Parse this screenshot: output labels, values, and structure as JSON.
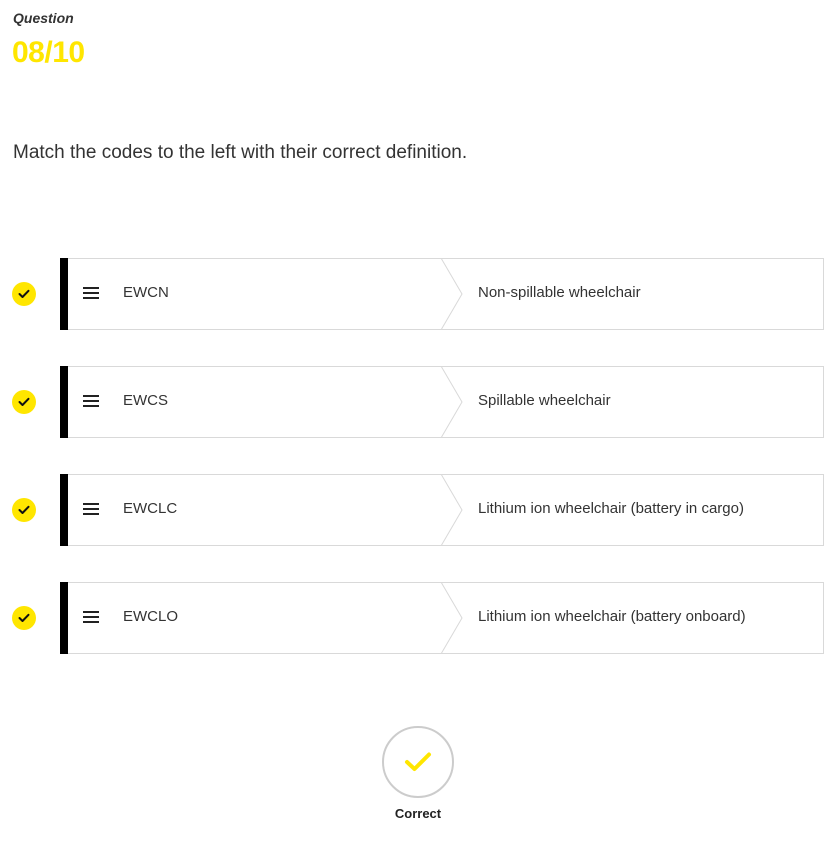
{
  "header": {
    "label": "Question",
    "counter": "08/10"
  },
  "prompt": "Match the codes to the left with their correct definition.",
  "colors": {
    "accent": "#ffe600",
    "bar": "#000000",
    "border": "#d9d9d9"
  },
  "matches": [
    {
      "code": "EWCN",
      "definition": "Non-spillable wheelchair",
      "status_icon": "check-icon"
    },
    {
      "code": "EWCS",
      "definition": "Spillable wheelchair",
      "status_icon": "check-icon"
    },
    {
      "code": "EWCLC",
      "definition": "Lithium ion wheelchair (battery in cargo)",
      "status_icon": "check-icon"
    },
    {
      "code": "EWCLO",
      "definition": "Lithium ion wheelchair (battery onboard)",
      "status_icon": "check-icon"
    }
  ],
  "result": {
    "icon": "check-icon",
    "label": "Correct"
  }
}
